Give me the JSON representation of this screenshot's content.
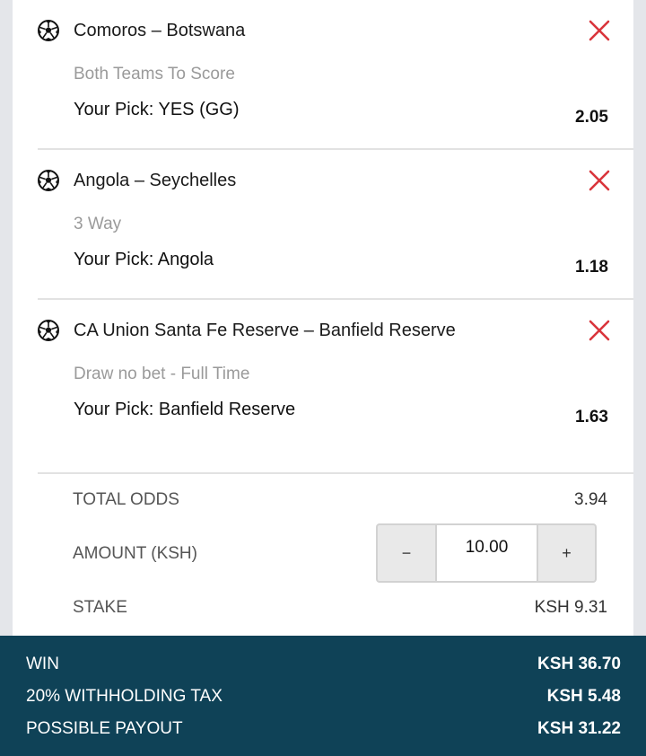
{
  "colors": {
    "remove_icon": "#d9343b",
    "footer_bg": "#0f4257",
    "market_text": "#9a9a9a"
  },
  "bets": [
    {
      "icon": "soccer-ball-icon",
      "match": "Comoros – Botswana",
      "market": "Both Teams To Score",
      "pick": "Your Pick: YES (GG)",
      "odds": "2.05"
    },
    {
      "icon": "soccer-ball-icon",
      "match": "Angola – Seychelles",
      "market": "3 Way",
      "pick": "Your Pick: Angola",
      "odds": "1.18"
    },
    {
      "icon": "soccer-ball-icon",
      "match": "CA Union Santa Fe Reserve – Banfield Reserve",
      "market": "Draw no bet - Full Time",
      "pick": "Your Pick: Banfield Reserve",
      "odds": "1.63"
    }
  ],
  "summary": {
    "total_odds_label": "TOTAL ODDS",
    "total_odds_value": "3.94",
    "amount_label": "AMOUNT (KSH)",
    "amount_value": "10.00",
    "decrement_symbol": "−",
    "increment_symbol": "+",
    "stake_label": "STAKE",
    "stake_value": "KSH 9.31"
  },
  "footer": {
    "win_label": "WIN",
    "win_value": "KSH 36.70",
    "tax_label": "20% WITHHOLDING TAX",
    "tax_value": "KSH 5.48",
    "payout_label": "POSSIBLE PAYOUT",
    "payout_value": "KSH 31.22"
  }
}
